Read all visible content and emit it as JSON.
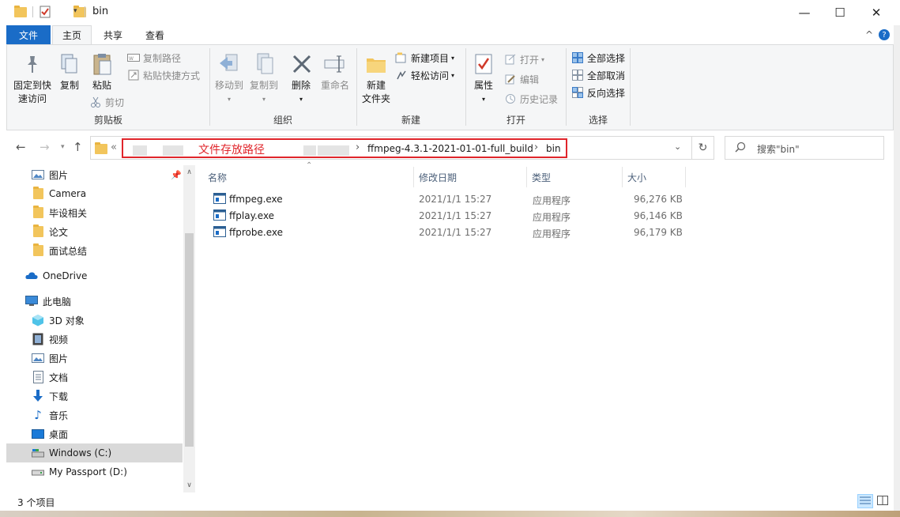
{
  "window": {
    "title": "bin",
    "minimize": "—",
    "maximize": "☐",
    "close": "✕"
  },
  "tabs": {
    "file": "文件",
    "home": "主页",
    "share": "共享",
    "view": "查看",
    "collapse": "^",
    "help": "?"
  },
  "ribbon": {
    "clipboard": {
      "label": "剪贴板",
      "pin_line1": "固定到快",
      "pin_line2": "速访问",
      "copy": "复制",
      "paste": "粘贴",
      "copy_path": "复制路径",
      "paste_shortcut": "粘贴快捷方式",
      "cut": "剪切"
    },
    "organize": {
      "label": "组织",
      "move_to": "移动到",
      "copy_to": "复制到",
      "delete": "删除",
      "rename": "重命名"
    },
    "new": {
      "label": "新建",
      "new_folder_line1": "新建",
      "new_folder_line2": "文件夹",
      "new_item": "新建项目",
      "easy_access": "轻松访问"
    },
    "open": {
      "label": "打开",
      "properties": "属性",
      "open": "打开",
      "edit": "编辑",
      "history": "历史记录"
    },
    "select": {
      "label": "选择",
      "select_all": "全部选择",
      "select_none": "全部取消",
      "invert": "反向选择"
    }
  },
  "address": {
    "overflow": "«",
    "annotation": "文件存放路径",
    "crumb1": "ffmpeg-4.3.1-2021-01-01-full_build",
    "crumb2": "bin",
    "chevron": "›",
    "search_placeholder": "搜索\"bin\""
  },
  "nav": {
    "items": [
      {
        "label": "图片",
        "icon": "pictures-icon"
      },
      {
        "label": "Camera",
        "icon": "folder-icon"
      },
      {
        "label": "毕设相关",
        "icon": "folder-icon"
      },
      {
        "label": "论文",
        "icon": "folder-icon"
      },
      {
        "label": "面试总结",
        "icon": "folder-icon"
      },
      {
        "label": "OneDrive",
        "icon": "onedrive-icon"
      },
      {
        "label": "此电脑",
        "icon": "this-pc-icon"
      },
      {
        "label": "3D 对象",
        "icon": "3d-objects-icon"
      },
      {
        "label": "视频",
        "icon": "videos-icon"
      },
      {
        "label": "图片",
        "icon": "pictures-icon"
      },
      {
        "label": "文档",
        "icon": "documents-icon"
      },
      {
        "label": "下载",
        "icon": "downloads-icon"
      },
      {
        "label": "音乐",
        "icon": "music-icon"
      },
      {
        "label": "桌面",
        "icon": "desktop-icon"
      },
      {
        "label": "Windows (C:)",
        "icon": "drive-c-icon"
      },
      {
        "label": "My Passport (D:)",
        "icon": "drive-d-icon"
      }
    ]
  },
  "columns": {
    "name": "名称",
    "date": "修改日期",
    "type": "类型",
    "size": "大小"
  },
  "files": [
    {
      "name": "ffmpeg.exe",
      "date": "2021/1/1 15:27",
      "type": "应用程序",
      "size": "96,276 KB"
    },
    {
      "name": "ffplay.exe",
      "date": "2021/1/1 15:27",
      "type": "应用程序",
      "size": "96,146 KB"
    },
    {
      "name": "ffprobe.exe",
      "date": "2021/1/1 15:27",
      "type": "应用程序",
      "size": "96,179 KB"
    }
  ],
  "status": {
    "count": "3 个项目"
  },
  "colors": {
    "accent": "#1a6cc7",
    "highlight_red": "#e0252b",
    "folder": "#f2c55c"
  }
}
